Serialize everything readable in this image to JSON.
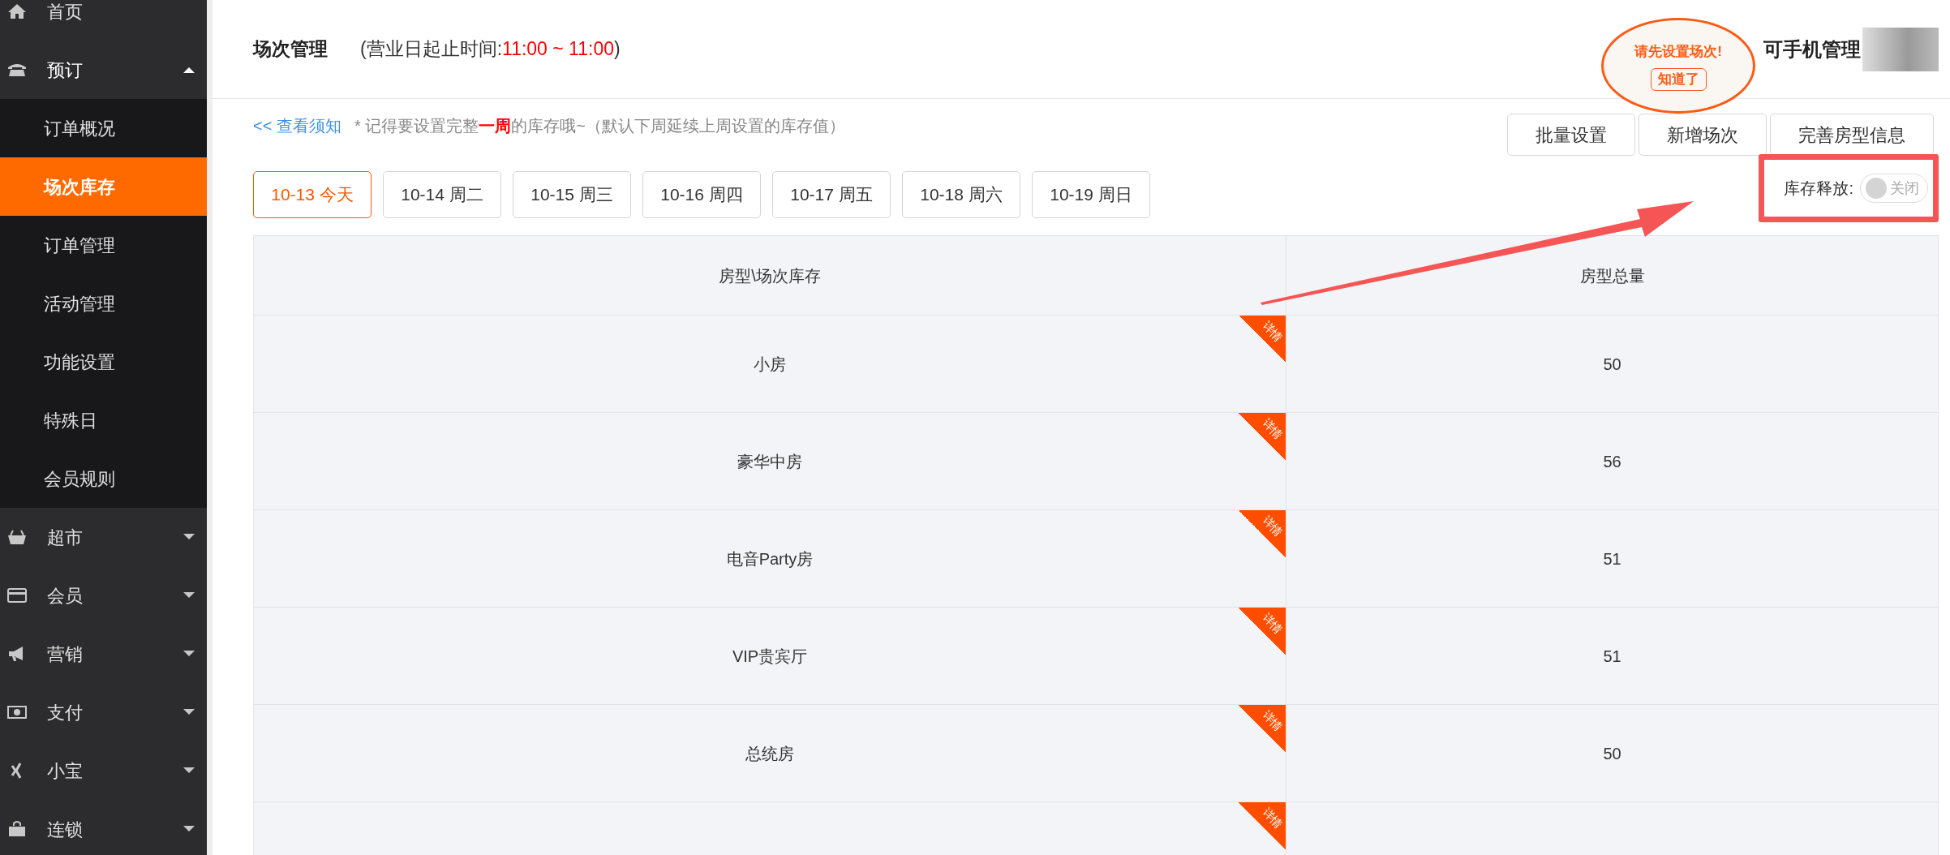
{
  "sidebar": {
    "items": [
      {
        "label": "首页",
        "kind": "link",
        "expanded": false
      },
      {
        "label": "预订",
        "kind": "group",
        "expanded": true,
        "children": [
          {
            "label": "订单概况",
            "selected": false
          },
          {
            "label": "场次库存",
            "selected": true
          },
          {
            "label": "订单管理",
            "selected": false
          },
          {
            "label": "活动管理",
            "selected": false
          },
          {
            "label": "功能设置",
            "selected": false
          },
          {
            "label": "特殊日",
            "selected": false
          },
          {
            "label": "会员规则",
            "selected": false
          }
        ]
      },
      {
        "label": "超市",
        "kind": "group",
        "expanded": false
      },
      {
        "label": "会员",
        "kind": "group",
        "expanded": false
      },
      {
        "label": "营销",
        "kind": "group",
        "expanded": false
      },
      {
        "label": "支付",
        "kind": "group",
        "expanded": false
      },
      {
        "label": "小宝",
        "kind": "group",
        "expanded": false
      },
      {
        "label": "连锁",
        "kind": "group",
        "expanded": false
      }
    ]
  },
  "header": {
    "title": "场次管理",
    "hours": "(营业日起止时间:**11:00 ~ 11:00**)",
    "right_text": "可手机管理"
  },
  "tip_bubble": {
    "message": "请先设置场次!",
    "button": "知道了"
  },
  "notice": {
    "link": "<< 查看须知",
    "text": "* 记得要设置完整**一周**的库存哦~（默认下周延续上周设置的库存值）"
  },
  "actions": [
    "批量设置",
    "新增场次",
    "完善房型信息"
  ],
  "date_tabs": [
    {
      "label": "10-13 今天",
      "selected": true
    },
    {
      "label": "10-14 周二",
      "selected": false
    },
    {
      "label": "10-15 周三",
      "selected": false
    },
    {
      "label": "10-16 周四",
      "selected": false
    },
    {
      "label": "10-17 周五",
      "selected": false
    },
    {
      "label": "10-18 周六",
      "selected": false
    },
    {
      "label": "10-19 周日",
      "selected": false
    }
  ],
  "stock_release": {
    "label": "库存释放:",
    "on": false,
    "state_text": "关闭"
  },
  "table": {
    "columns": [
      "房型\\场次库存",
      "房型总量"
    ],
    "rows": [
      {
        "name": "小房",
        "total": "50",
        "tag": "详情"
      },
      {
        "name": "豪华中房",
        "total": "56",
        "tag": "详情"
      },
      {
        "name": "电音Party房",
        "total": "51",
        "tag": "详情"
      },
      {
        "name": "VIP贵宾厅",
        "total": "51",
        "tag": "详情"
      },
      {
        "name": "总统房",
        "total": "50",
        "tag": "详情"
      },
      {
        "tag": "详情"
      }
    ]
  }
}
